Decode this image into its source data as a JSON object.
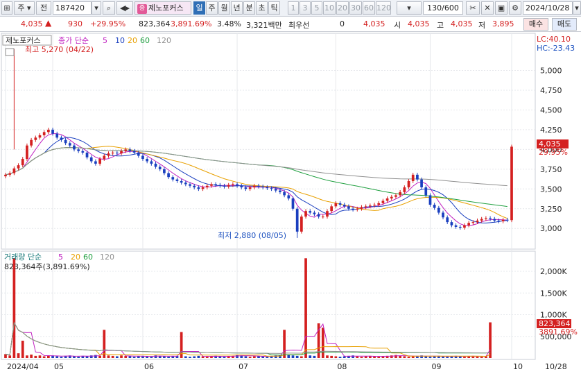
{
  "toolbar": {
    "code": "187420",
    "market": "주",
    "prefix": "전",
    "stock_badge": "증",
    "stock_name": "제노포커스",
    "periods": [
      "일",
      "주",
      "월",
      "년",
      "분",
      "초",
      "틱"
    ],
    "selected_period": "일",
    "intervals": [
      "1",
      "3",
      "5",
      "10",
      "20",
      "30",
      "60",
      "120"
    ],
    "count": "130/600",
    "date": "2024/10/28"
  },
  "quote": {
    "price": "4,035",
    "change": "930",
    "change_pct": "+29.95%",
    "volume": "823,364",
    "volume_pct": "3,891.69%",
    "turnover_pct": "3.48%",
    "trade_value": "3,321백만",
    "priority_label": "최우선",
    "priority_value": "0",
    "ask_price": "4,035",
    "open_label": "시",
    "open": "4,035",
    "high_label": "고",
    "high": "4,035",
    "low_label": "저",
    "low": "3,895",
    "buy_button": "매수",
    "sell_button": "매도"
  },
  "chart_data": {
    "type": "candlestick",
    "stock": "제노포커스",
    "legend": {
      "price": "종가 단순",
      "ma_periods": [
        "5",
        "10",
        "20",
        "60",
        "120"
      ],
      "ma_colors": [
        "#c020c0",
        "#1a3fbf",
        "#e8a000",
        "#20a040",
        "#909090"
      ],
      "volume_title": "거래량 단순",
      "vol_ma_periods": [
        "5",
        "20",
        "60",
        "120"
      ],
      "volume_value": "823,364주(3,891.69%)"
    },
    "price_axis": {
      "ticks": [
        3000,
        3250,
        3500,
        3750,
        4000,
        4250,
        4500,
        4750,
        5000
      ],
      "tick_labels": [
        "3,000",
        "3,250",
        "3,500",
        "3,750",
        "4,000",
        "4,250",
        "4,500",
        "4,750",
        "5,000"
      ],
      "range": [
        2800,
        5400
      ],
      "lc": "LC:40.10",
      "hc": "HC:-23.43",
      "current_label": "4,035",
      "current_pct": "29.95%"
    },
    "volume_axis": {
      "ticks": [
        500000,
        1000000,
        1500000,
        2000000
      ],
      "tick_labels": [
        "500,000",
        "1,000K",
        "1,500K",
        "2,000K"
      ],
      "range": [
        0,
        2400000
      ],
      "current_label": "823,364",
      "current_pct": "3891.69%"
    },
    "annotations": {
      "high": "최고 5,270 (04/22)",
      "low": "최저 2,880 (08/05)"
    },
    "x_labels": [
      "2024/04",
      "05",
      "06",
      "07",
      "08",
      "09",
      "10"
    ],
    "x_label_index": [
      0,
      11,
      32,
      54,
      77,
      99,
      118
    ],
    "end_label": "10/28",
    "closes": [
      3680,
      3700,
      3760,
      3800,
      3880,
      4050,
      4120,
      4150,
      4180,
      4220,
      4250,
      4200,
      4150,
      4120,
      4080,
      4050,
      4000,
      3980,
      3960,
      3900,
      3850,
      3820,
      3880,
      3920,
      3950,
      3960,
      3950,
      3980,
      4000,
      3980,
      3960,
      3920,
      3880,
      3850,
      3820,
      3780,
      3750,
      3700,
      3650,
      3620,
      3600,
      3580,
      3560,
      3540,
      3520,
      3500,
      3520,
      3540,
      3560,
      3550,
      3540,
      3530,
      3550,
      3560,
      3540,
      3520,
      3500,
      3520,
      3540,
      3530,
      3520,
      3510,
      3500,
      3480,
      3460,
      3420,
      3380,
      3250,
      2960,
      3150,
      3220,
      3200,
      3180,
      3150,
      3150,
      3220,
      3280,
      3320,
      3300,
      3280,
      3250,
      3240,
      3250,
      3270,
      3280,
      3290,
      3300,
      3320,
      3350,
      3380,
      3400,
      3420,
      3460,
      3520,
      3600,
      3680,
      3620,
      3520,
      3420,
      3300,
      3260,
      3200,
      3140,
      3080,
      3040,
      3020,
      3010,
      3040,
      3070,
      3080,
      3100,
      3120,
      3130,
      3120,
      3100,
      3090,
      3110,
      3105,
      4035
    ],
    "volumes": [
      90000,
      60000,
      2300000,
      110000,
      400000,
      60000,
      80000,
      50000,
      60000,
      40000,
      50000,
      60000,
      40000,
      30000,
      50000,
      60000,
      40000,
      30000,
      50000,
      40000,
      60000,
      70000,
      50000,
      650000,
      60000,
      50000,
      40000,
      60000,
      50000,
      40000,
      30000,
      40000,
      50000,
      40000,
      30000,
      60000,
      50000,
      40000,
      30000,
      40000,
      50000,
      600000,
      40000,
      30000,
      40000,
      50000,
      40000,
      30000,
      40000,
      50000,
      40000,
      30000,
      40000,
      50000,
      80000,
      60000,
      40000,
      30000,
      40000,
      50000,
      40000,
      30000,
      40000,
      60000,
      70000,
      650000,
      80000,
      60000,
      50000,
      40000,
      2300000,
      60000,
      50000,
      800000,
      700000,
      60000,
      50000,
      40000,
      30000,
      40000,
      50000,
      60000,
      40000,
      30000,
      40000,
      50000,
      40000,
      30000,
      40000,
      50000,
      60000,
      70000,
      50000,
      40000,
      30000,
      40000,
      50000,
      60000,
      40000,
      30000,
      40000,
      50000,
      40000,
      30000,
      40000,
      50000,
      40000,
      30000,
      40000,
      50000,
      40000,
      30000,
      40000,
      823364
    ]
  }
}
